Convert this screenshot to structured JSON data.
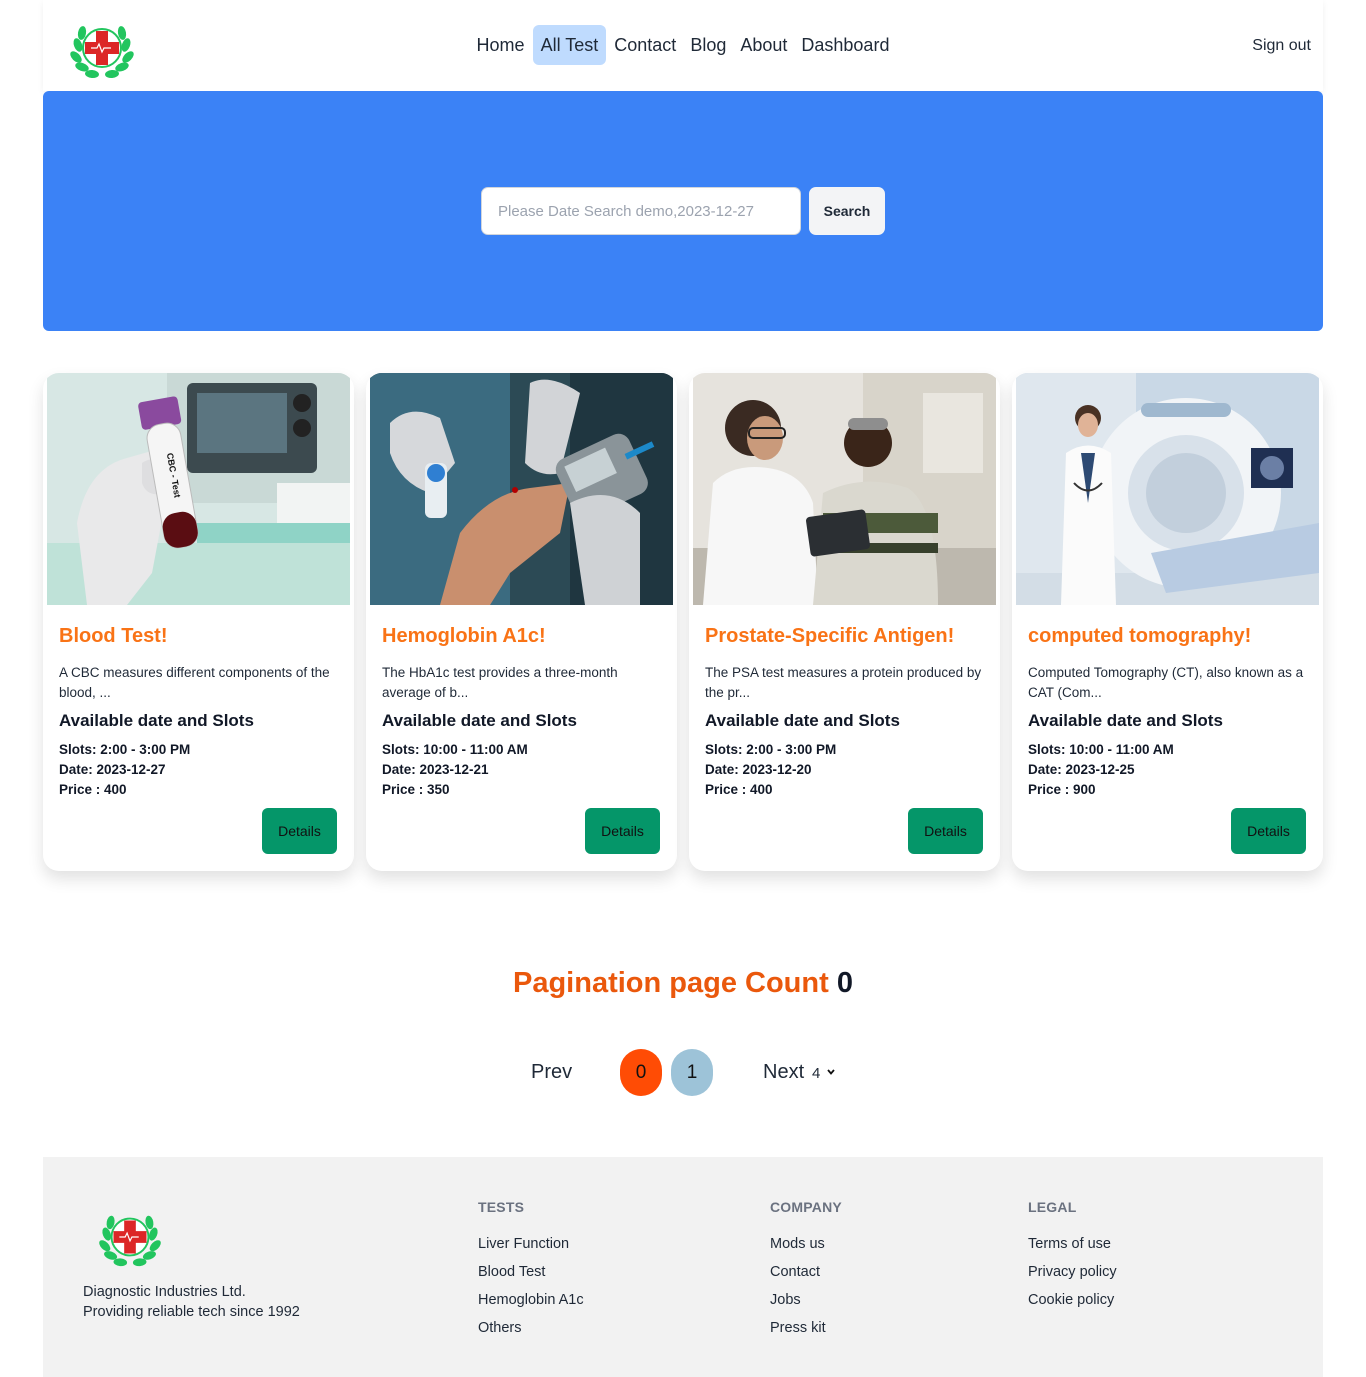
{
  "nav": {
    "links": [
      "Home",
      "All Test",
      "Contact",
      "Blog",
      "About",
      "Dashboard"
    ],
    "active": "All Test",
    "signout": "Sign out"
  },
  "search": {
    "placeholder": "Please Date Search demo,2023-12-27",
    "button": "Search"
  },
  "cards": [
    {
      "title": "Blood Test!",
      "desc": "A CBC measures different components of the blood, ...",
      "sub": "Available date and Slots",
      "slots": "Slots: 2:00 - 3:00 PM",
      "date": "Date: 2023-12-27",
      "price": "Price : 400",
      "button": "Details",
      "image_label": "CBC - Test"
    },
    {
      "title": "Hemoglobin A1c!",
      "desc": "The HbA1c test provides a three-month average of b...",
      "sub": "Available date and Slots",
      "slots": "Slots: 10:00 - 11:00 AM",
      "date": "Date: 2023-12-21",
      "price": "Price : 350",
      "button": "Details"
    },
    {
      "title": "Prostate-Specific Antigen!",
      "desc": "The PSA test measures a protein produced by the pr...",
      "sub": "Available date and Slots",
      "slots": "Slots: 2:00 - 3:00 PM",
      "date": "Date: 2023-12-20",
      "price": "Price : 400",
      "button": "Details"
    },
    {
      "title": "computed tomography!",
      "desc": "Computed Tomography (CT), also known as a CAT (Com...",
      "sub": "Available date and Slots",
      "slots": "Slots: 10:00 - 11:00 AM",
      "date": "Date: 2023-12-25",
      "price": "Price : 900",
      "button": "Details"
    }
  ],
  "pagination": {
    "title": "Pagination page Count",
    "count": "0",
    "prev": "Prev",
    "pages": [
      "0",
      "1"
    ],
    "current": "0",
    "next": "Next",
    "per_page": "4"
  },
  "footer": {
    "company_line1": "Diagnostic Industries Ltd.",
    "company_line2": "Providing reliable tech since 1992",
    "columns": [
      {
        "heading": "TESTS",
        "links": [
          "Liver Function",
          "Blood Test",
          "Hemoglobin A1c",
          "Others"
        ]
      },
      {
        "heading": "COMPANY",
        "links": [
          "Mods us",
          "Contact",
          "Jobs",
          "Press kit"
        ]
      },
      {
        "heading": "LEGAL",
        "links": [
          "Terms of use",
          "Privacy policy",
          "Cookie policy"
        ]
      }
    ]
  },
  "colors": {
    "hero": "#3b82f6",
    "card_title": "#f97316",
    "details_button": "#059669",
    "active_page": "#ff4c05",
    "page": "#9dc3d8",
    "nav_active": "#bfdbfe"
  }
}
